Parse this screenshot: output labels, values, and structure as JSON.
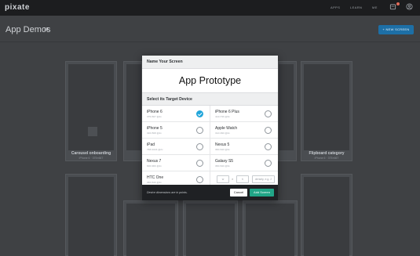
{
  "topbar": {
    "logo": "pixate",
    "nav": [
      "APPS",
      "LEARN",
      "ME"
    ]
  },
  "page": {
    "title": "App Demos",
    "count": "18",
    "new_screen_label": "+ NEW SCREEN"
  },
  "cards": [
    {
      "label": "Carousel onboarding",
      "sub": "iPhone 6 · 375×667"
    },
    {
      "label": "Flipboard category",
      "sub": "iPhone 6 · 375×667"
    }
  ],
  "modal": {
    "name_header": "Name Your Screen",
    "screen_name": "App Prototype",
    "device_header": "Select its Target Device",
    "devices": [
      {
        "name": "iPhone 6",
        "dims": "375×667 @2x",
        "selected": true
      },
      {
        "name": "iPhone 6 Plus",
        "dims": "414×736 @3x",
        "selected": false
      },
      {
        "name": "iPhone 5",
        "dims": "320×568 @2x",
        "selected": false
      },
      {
        "name": "Apple Watch",
        "dims": "312×390 @2x",
        "selected": false
      },
      {
        "name": "iPad",
        "dims": "768×1024 @2x",
        "selected": false
      },
      {
        "name": "Nexus 5",
        "dims": "360×640 @3x",
        "selected": false
      },
      {
        "name": "Nexus 7",
        "dims": "600×960 @2x",
        "selected": false
      },
      {
        "name": "Galaxy S5",
        "dims": "360×640 @3x",
        "selected": false
      },
      {
        "name": "HTC One",
        "dims": "360×640 @3x",
        "selected": false
      }
    ],
    "custom": {
      "width_placeholder": "w",
      "height_placeholder": "h",
      "separator": "×",
      "density_placeholder": "density, e.g. 2"
    },
    "footer_note": "Device dimensions are in points.",
    "cancel_label": "Cancel",
    "add_label": "Add Screen"
  },
  "colors": {
    "selected_radio": "#21a5da",
    "add_button": "#21a587",
    "new_screen_button": "#1d6fa6"
  }
}
